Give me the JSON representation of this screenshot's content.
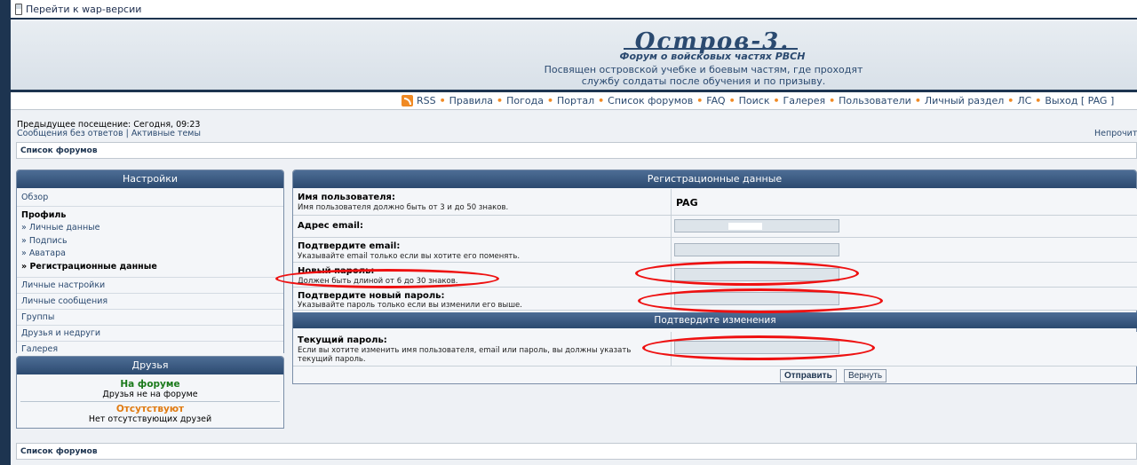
{
  "wapbar": {
    "label": "Перейти к wap-версии",
    "icon": "mobile-phone-icon"
  },
  "header": {
    "logo_title": "Остров-3.",
    "logo_subtitle": "Форум о войсковых частях РВСН",
    "tagline_1": "Посвящен островской учебке и боевым частям, где проходят",
    "tagline_2": "службу солдаты после обучения и по призыву."
  },
  "nav": {
    "items": [
      "RSS",
      "Правила",
      "Погода",
      "Портал",
      "Список форумов",
      "FAQ",
      "Поиск",
      "Галерея",
      "Пользователи",
      "Личный раздел",
      "ЛС",
      "Выход [ PAG ]"
    ],
    "separator": "•"
  },
  "visit": {
    "previous": "Предыдущее посещение: Сегодня, 09:23",
    "link_no_answers": "Сообщения без ответов",
    "link_sep": "|",
    "link_active": "Активные темы",
    "unread": "Непрочита"
  },
  "breadcrumb": {
    "label": "Список форумов"
  },
  "sidebar": {
    "title": "Настройки",
    "overview": "Обзор",
    "profile_title": "Профиль",
    "profile_items": [
      "» Личные данные",
      "» Подпись",
      "» Аватара",
      "» Регистрационные данные"
    ],
    "items": [
      "Личные настройки",
      "Личные сообщения",
      "Группы",
      "Друзья и недруги",
      "Галерея"
    ]
  },
  "friends": {
    "title": "Друзья",
    "online_title": "На форуме",
    "online_text": "Друзья не на форуме",
    "offline_title": "Отсутствуют",
    "offline_text": "Нет отсутствующих друзей"
  },
  "form": {
    "title": "Регистрационные данные",
    "username_label": "Имя пользователя:",
    "username_hint": "Имя пользователя должно быть от 3 и до 50 знаков.",
    "username_value": "PAG",
    "email_label": "Адрес email:",
    "email_confirm_label": "Подтвердите email:",
    "email_confirm_hint": "Указывайте email только если вы хотите его поменять.",
    "new_password_label": "Новый пароль:",
    "new_password_hint": "Должен быть длиной от 6 до 30 знаков.",
    "confirm_password_label": "Подтвердите новый пароль:",
    "confirm_password_hint": "Указывайте пароль только если вы изменили его выше.",
    "confirm_changes_title": "Подтвердите изменения",
    "current_password_label": "Текущий пароль:",
    "current_password_hint": "Если вы хотите изменить имя пользователя, email или пароль, вы должны указать текущий пароль.",
    "submit_label": "Отправить",
    "reset_label": "Вернуть"
  },
  "colors": {
    "header_blue": "#2c4a70",
    "annotation_red": "#e11111",
    "online_green": "#1b7a1b",
    "offline_orange": "#e07a10"
  }
}
